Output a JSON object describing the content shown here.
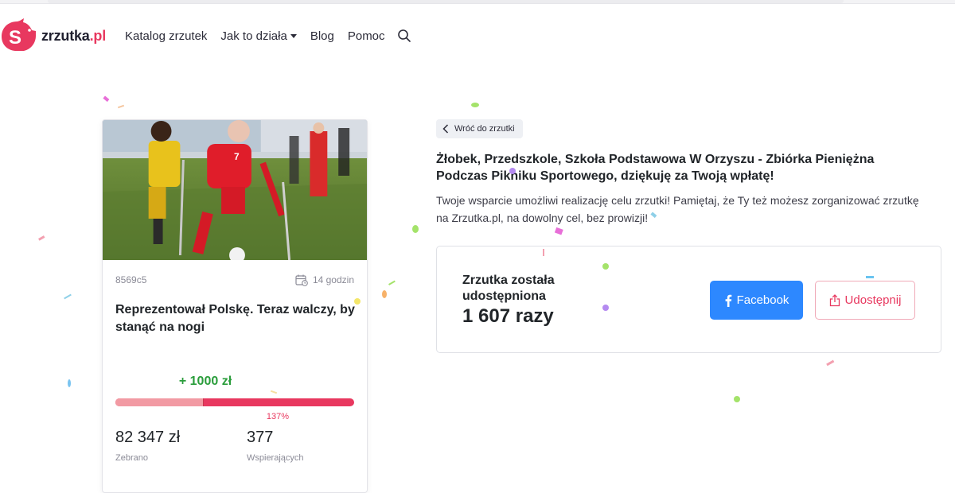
{
  "header": {
    "logo_text": "zrzutka",
    "logo_tld": ".pl",
    "nav": {
      "catalog": "Katalog zrzutek",
      "how": "Jak to działa",
      "blog": "Blog",
      "help": "Pomoc"
    }
  },
  "card": {
    "code": "8569c5",
    "time": "14 godzin",
    "title": "Reprezentował Polskę. Teraz walczy, by stanąć na nogi",
    "added": "+ 1000 zł",
    "progress_base_fraction": 0.37,
    "percent": "137%",
    "collected_value": "82 347 zł",
    "collected_label": "Zebrano",
    "supporters_value": "377",
    "supporters_label": "Wspierających",
    "photo_shirt_number": "7"
  },
  "main": {
    "back_label": "Wróć do zrzutki",
    "title": "Żłobek, Przedszkole, Szkoła Podstawowa W Orzyszu - Zbiórka Pieniężna Podczas Pikniku Sportowego, dziękuję za Twoją wpłatę!",
    "description": "Twoje wsparcie umożliwi realizację celu zrzutki! Pamiętaj, że Ty też możesz zorganizować zrzutkę na Zrzutka.pl, na dowolny cel, bez prowizji!"
  },
  "share": {
    "label": "Zrzutka została udostępniona",
    "count": "1 607 razy",
    "facebook_label": "Facebook",
    "share_label": "Udostępnij"
  },
  "colors": {
    "brand": "#e8385f",
    "facebook": "#2d88ff",
    "success": "#2a9d3b"
  }
}
